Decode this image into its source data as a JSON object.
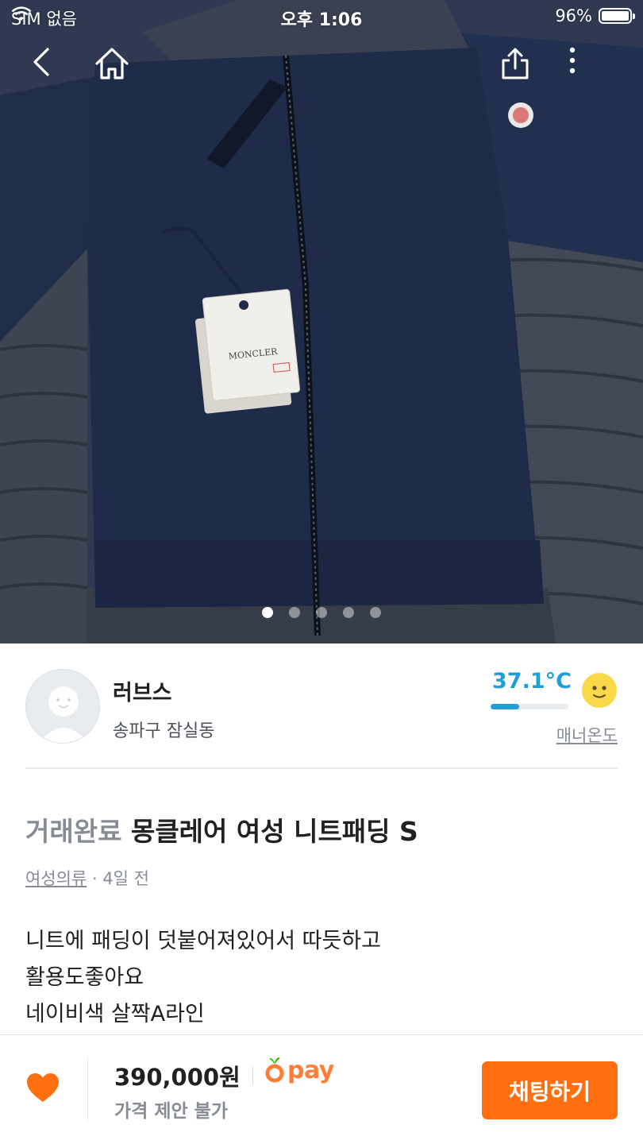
{
  "status_bar": {
    "carrier": "SIM 없음",
    "time": "오후 1:06",
    "battery": "96%"
  },
  "photo": {
    "tag_text": "MONCLER",
    "page_count": 5,
    "current_page": 1
  },
  "seller": {
    "name": "러브스",
    "location": "송파구 잠실동",
    "temperature": "37.1°C",
    "temperature_value": 37.1,
    "manner_label": "매너온도"
  },
  "article": {
    "status": "거래완료",
    "title": "몽클레어 여성 니트패딩 S",
    "category": "여성의류",
    "time": "· 4일 전",
    "description": [
      "니트에 패딩이 덧붙어져있어서 따듯하고",
      "활용도좋아요",
      "네이비색 살짝A라인"
    ]
  },
  "bottom_bar": {
    "price": "390,000원",
    "negotiation": "가격 제안 불가",
    "pay_label": "pay",
    "chat_button": "채팅하기"
  },
  "colors": {
    "accent": "#ff6f0f",
    "temperature": "#1e9fd8",
    "muted": "#868b94"
  }
}
